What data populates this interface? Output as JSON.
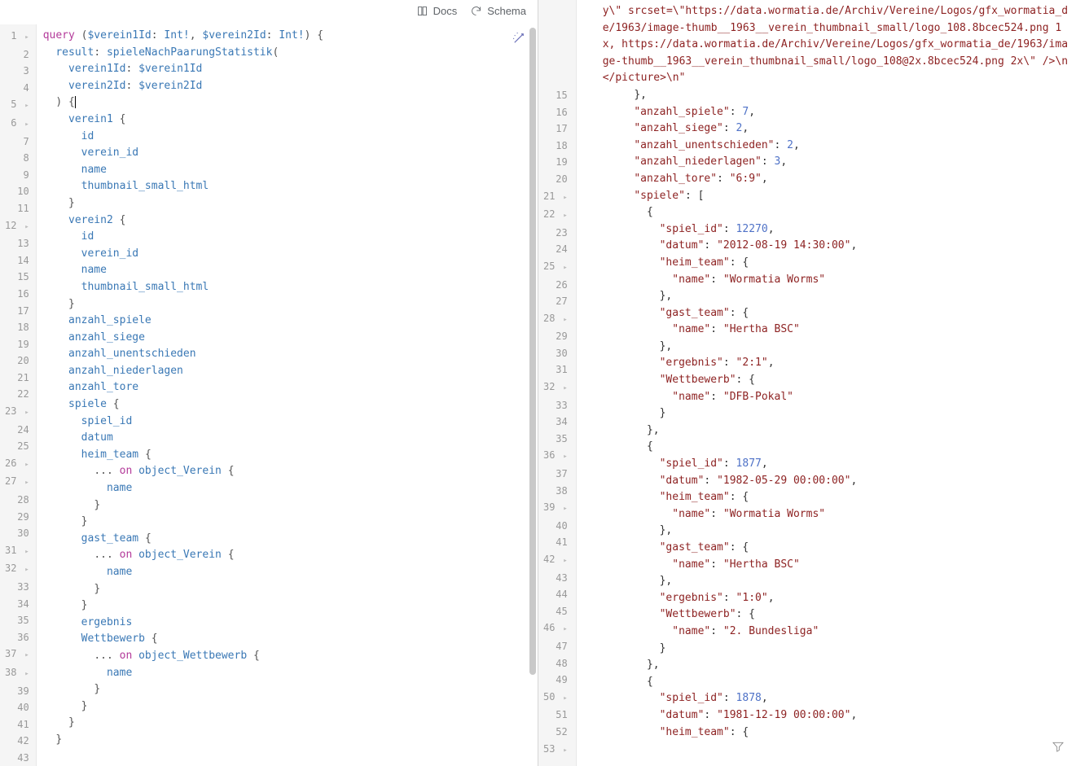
{
  "toolbar": {
    "docs_label": "Docs",
    "schema_label": "Schema"
  },
  "left_gutter_start": 1,
  "left_gutter_end": 43,
  "query_lines": [
    {
      "indent": 0,
      "fold": true,
      "html": "<span class='tok-kw'>query</span> <span class='tok-punc'>(</span><span class='tok-type'>$verein1Id</span><span class='tok-punc'>:</span> <span class='tok-type'>Int!</span><span class='tok-punc'>,</span> <span class='tok-type'>$verein2Id</span><span class='tok-punc'>:</span> <span class='tok-type'>Int!</span><span class='tok-punc'>)</span> <span class='tok-punc'>{</span>"
    },
    {
      "indent": 1,
      "html": "<span class='tok-alias'>result</span><span class='tok-punc'>:</span> <span class='tok-field'>spieleNachPaarungStatistik</span><span class='tok-punc'>(</span>"
    },
    {
      "indent": 2,
      "html": "<span class='tok-field'>verein1Id</span><span class='tok-punc'>:</span> <span class='tok-type'>$verein1Id</span>"
    },
    {
      "indent": 2,
      "html": "<span class='tok-field'>verein2Id</span><span class='tok-punc'>:</span> <span class='tok-type'>$verein2Id</span>"
    },
    {
      "indent": 1,
      "fold": true,
      "cursor": true,
      "html": "<span class='tok-punc'>)</span> <span class='tok-punc'>{</span>"
    },
    {
      "indent": 2,
      "fold": true,
      "html": "<span class='tok-field'>verein1</span> <span class='tok-punc'>{</span>"
    },
    {
      "indent": 3,
      "html": "<span class='tok-field'>id</span>"
    },
    {
      "indent": 3,
      "html": "<span class='tok-field'>verein_id</span>"
    },
    {
      "indent": 3,
      "html": "<span class='tok-field'>name</span>"
    },
    {
      "indent": 3,
      "html": "<span class='tok-field'>thumbnail_small_html</span>"
    },
    {
      "indent": 2,
      "html": "<span class='tok-punc'>}</span>"
    },
    {
      "indent": 2,
      "fold": true,
      "html": "<span class='tok-field'>verein2</span> <span class='tok-punc'>{</span>"
    },
    {
      "indent": 3,
      "html": "<span class='tok-field'>id</span>"
    },
    {
      "indent": 3,
      "html": "<span class='tok-field'>verein_id</span>"
    },
    {
      "indent": 3,
      "html": "<span class='tok-field'>name</span>"
    },
    {
      "indent": 3,
      "html": "<span class='tok-field'>thumbnail_small_html</span>"
    },
    {
      "indent": 2,
      "html": "<span class='tok-punc'>}</span>"
    },
    {
      "indent": 2,
      "html": "<span class='tok-field'>anzahl_spiele</span>"
    },
    {
      "indent": 2,
      "html": "<span class='tok-field'>anzahl_siege</span>"
    },
    {
      "indent": 2,
      "html": "<span class='tok-field'>anzahl_unentschieden</span>"
    },
    {
      "indent": 2,
      "html": "<span class='tok-field'>anzahl_niederlagen</span>"
    },
    {
      "indent": 2,
      "html": "<span class='tok-field'>anzahl_tore</span>"
    },
    {
      "indent": 2,
      "fold": true,
      "html": "<span class='tok-field'>spiele</span> <span class='tok-punc'>{</span>"
    },
    {
      "indent": 3,
      "html": "<span class='tok-field'>spiel_id</span>"
    },
    {
      "indent": 3,
      "html": "<span class='tok-field'>datum</span>"
    },
    {
      "indent": 3,
      "fold": true,
      "html": "<span class='tok-field'>heim_team</span> <span class='tok-punc'>{</span>"
    },
    {
      "indent": 4,
      "fold": true,
      "html": "<span class='tok-punc'>...</span> <span class='tok-kw'>on</span> <span class='tok-type'>object_Verein</span> <span class='tok-punc'>{</span>"
    },
    {
      "indent": 5,
      "html": "<span class='tok-field'>name</span>"
    },
    {
      "indent": 4,
      "html": "<span class='tok-punc'>}</span>"
    },
    {
      "indent": 3,
      "html": "<span class='tok-punc'>}</span>"
    },
    {
      "indent": 3,
      "fold": true,
      "html": "<span class='tok-field'>gast_team</span> <span class='tok-punc'>{</span>"
    },
    {
      "indent": 4,
      "fold": true,
      "html": "<span class='tok-punc'>...</span> <span class='tok-kw'>on</span> <span class='tok-type'>object_Verein</span> <span class='tok-punc'>{</span>"
    },
    {
      "indent": 5,
      "html": "<span class='tok-field'>name</span>"
    },
    {
      "indent": 4,
      "html": "<span class='tok-punc'>}</span>"
    },
    {
      "indent": 3,
      "html": "<span class='tok-punc'>}</span>"
    },
    {
      "indent": 3,
      "html": "<span class='tok-field'>ergebnis</span>"
    },
    {
      "indent": 3,
      "fold": true,
      "html": "<span class='tok-field'>Wettbewerb</span> <span class='tok-punc'>{</span>"
    },
    {
      "indent": 4,
      "fold": true,
      "html": "<span class='tok-punc'>...</span> <span class='tok-kw'>on</span> <span class='tok-type'>object_Wettbewerb</span> <span class='tok-punc'>{</span>"
    },
    {
      "indent": 5,
      "html": "<span class='tok-field'>name</span>"
    },
    {
      "indent": 4,
      "html": "<span class='tok-punc'>}</span>"
    },
    {
      "indent": 3,
      "html": "<span class='tok-punc'>}</span>"
    },
    {
      "indent": 2,
      "html": "<span class='tok-punc'>}</span>"
    },
    {
      "indent": 1,
      "html": "<span class='tok-punc'>}</span>"
    }
  ],
  "right_top_text": "y\\\" srcset=\\\"https://data.wormatia.de/Archiv/Vereine/Logos/gfx_wormatia_de/1963/image-thumb__1963__verein_thumbnail_small/logo_108.8bcec524.png 1x, https://data.wormatia.de/Archiv/Vereine/Logos/gfx_wormatia_de/1963/image-thumb__1963__verein_thumbnail_small/logo_108@2x.8bcec524.png 2x\\\" />\\n</picture>\\n\"",
  "right_gutter": [
    15,
    16,
    17,
    18,
    19,
    20,
    21,
    22,
    23,
    24,
    25,
    26,
    27,
    28,
    29,
    30,
    31,
    32,
    33,
    34,
    35,
    36,
    37,
    38,
    39,
    40,
    41,
    42,
    43,
    44,
    45,
    46,
    47,
    48,
    49,
    50,
    51,
    52,
    53
  ],
  "right_fold_lines": [
    21,
    22,
    25,
    28,
    32,
    36,
    39,
    42,
    46,
    50,
    53
  ],
  "result_lines": [
    {
      "n": 15,
      "indent": 4,
      "parts": [
        {
          "t": "plain",
          "v": "},"
        }
      ]
    },
    {
      "n": 16,
      "indent": 4,
      "parts": [
        {
          "t": "key",
          "v": "\"anzahl_spiele\""
        },
        {
          "t": "plain",
          "v": ": "
        },
        {
          "t": "num",
          "v": "7"
        },
        {
          "t": "plain",
          "v": ","
        }
      ]
    },
    {
      "n": 17,
      "indent": 4,
      "parts": [
        {
          "t": "key",
          "v": "\"anzahl_siege\""
        },
        {
          "t": "plain",
          "v": ": "
        },
        {
          "t": "num",
          "v": "2"
        },
        {
          "t": "plain",
          "v": ","
        }
      ]
    },
    {
      "n": 18,
      "indent": 4,
      "parts": [
        {
          "t": "key",
          "v": "\"anzahl_unentschieden\""
        },
        {
          "t": "plain",
          "v": ": "
        },
        {
          "t": "num",
          "v": "2"
        },
        {
          "t": "plain",
          "v": ","
        }
      ]
    },
    {
      "n": 19,
      "indent": 4,
      "parts": [
        {
          "t": "key",
          "v": "\"anzahl_niederlagen\""
        },
        {
          "t": "plain",
          "v": ": "
        },
        {
          "t": "num",
          "v": "3"
        },
        {
          "t": "plain",
          "v": ","
        }
      ]
    },
    {
      "n": 20,
      "indent": 4,
      "parts": [
        {
          "t": "key",
          "v": "\"anzahl_tore\""
        },
        {
          "t": "plain",
          "v": ": "
        },
        {
          "t": "str",
          "v": "\"6:9\""
        },
        {
          "t": "plain",
          "v": ","
        }
      ]
    },
    {
      "n": 21,
      "indent": 4,
      "parts": [
        {
          "t": "key",
          "v": "\"spiele\""
        },
        {
          "t": "plain",
          "v": ": ["
        }
      ]
    },
    {
      "n": 22,
      "indent": 5,
      "parts": [
        {
          "t": "plain",
          "v": "{"
        }
      ]
    },
    {
      "n": 23,
      "indent": 6,
      "parts": [
        {
          "t": "key",
          "v": "\"spiel_id\""
        },
        {
          "t": "plain",
          "v": ": "
        },
        {
          "t": "num",
          "v": "12270"
        },
        {
          "t": "plain",
          "v": ","
        }
      ]
    },
    {
      "n": 24,
      "indent": 6,
      "parts": [
        {
          "t": "key",
          "v": "\"datum\""
        },
        {
          "t": "plain",
          "v": ": "
        },
        {
          "t": "str",
          "v": "\"2012-08-19 14:30:00\""
        },
        {
          "t": "plain",
          "v": ","
        }
      ]
    },
    {
      "n": 25,
      "indent": 6,
      "parts": [
        {
          "t": "key",
          "v": "\"heim_team\""
        },
        {
          "t": "plain",
          "v": ": {"
        }
      ]
    },
    {
      "n": 26,
      "indent": 7,
      "parts": [
        {
          "t": "key",
          "v": "\"name\""
        },
        {
          "t": "plain",
          "v": ": "
        },
        {
          "t": "str",
          "v": "\"Wormatia Worms\""
        }
      ]
    },
    {
      "n": 27,
      "indent": 6,
      "parts": [
        {
          "t": "plain",
          "v": "},"
        }
      ]
    },
    {
      "n": 28,
      "indent": 6,
      "parts": [
        {
          "t": "key",
          "v": "\"gast_team\""
        },
        {
          "t": "plain",
          "v": ": {"
        }
      ]
    },
    {
      "n": 29,
      "indent": 7,
      "parts": [
        {
          "t": "key",
          "v": "\"name\""
        },
        {
          "t": "plain",
          "v": ": "
        },
        {
          "t": "str",
          "v": "\"Hertha BSC\""
        }
      ]
    },
    {
      "n": 30,
      "indent": 6,
      "parts": [
        {
          "t": "plain",
          "v": "},"
        }
      ]
    },
    {
      "n": 31,
      "indent": 6,
      "parts": [
        {
          "t": "key",
          "v": "\"ergebnis\""
        },
        {
          "t": "plain",
          "v": ": "
        },
        {
          "t": "str",
          "v": "\"2:1\""
        },
        {
          "t": "plain",
          "v": ","
        }
      ]
    },
    {
      "n": 32,
      "indent": 6,
      "parts": [
        {
          "t": "key",
          "v": "\"Wettbewerb\""
        },
        {
          "t": "plain",
          "v": ": {"
        }
      ]
    },
    {
      "n": 33,
      "indent": 7,
      "parts": [
        {
          "t": "key",
          "v": "\"name\""
        },
        {
          "t": "plain",
          "v": ": "
        },
        {
          "t": "str",
          "v": "\"DFB-Pokal\""
        }
      ]
    },
    {
      "n": 34,
      "indent": 6,
      "parts": [
        {
          "t": "plain",
          "v": "}"
        }
      ]
    },
    {
      "n": 35,
      "indent": 5,
      "parts": [
        {
          "t": "plain",
          "v": "},"
        }
      ]
    },
    {
      "n": 36,
      "indent": 5,
      "parts": [
        {
          "t": "plain",
          "v": "{"
        }
      ]
    },
    {
      "n": 37,
      "indent": 6,
      "parts": [
        {
          "t": "key",
          "v": "\"spiel_id\""
        },
        {
          "t": "plain",
          "v": ": "
        },
        {
          "t": "num",
          "v": "1877"
        },
        {
          "t": "plain",
          "v": ","
        }
      ]
    },
    {
      "n": 38,
      "indent": 6,
      "parts": [
        {
          "t": "key",
          "v": "\"datum\""
        },
        {
          "t": "plain",
          "v": ": "
        },
        {
          "t": "str",
          "v": "\"1982-05-29 00:00:00\""
        },
        {
          "t": "plain",
          "v": ","
        }
      ]
    },
    {
      "n": 39,
      "indent": 6,
      "parts": [
        {
          "t": "key",
          "v": "\"heim_team\""
        },
        {
          "t": "plain",
          "v": ": {"
        }
      ]
    },
    {
      "n": 40,
      "indent": 7,
      "parts": [
        {
          "t": "key",
          "v": "\"name\""
        },
        {
          "t": "plain",
          "v": ": "
        },
        {
          "t": "str",
          "v": "\"Wormatia Worms\""
        }
      ]
    },
    {
      "n": 41,
      "indent": 6,
      "parts": [
        {
          "t": "plain",
          "v": "},"
        }
      ]
    },
    {
      "n": 42,
      "indent": 6,
      "parts": [
        {
          "t": "key",
          "v": "\"gast_team\""
        },
        {
          "t": "plain",
          "v": ": {"
        }
      ]
    },
    {
      "n": 43,
      "indent": 7,
      "parts": [
        {
          "t": "key",
          "v": "\"name\""
        },
        {
          "t": "plain",
          "v": ": "
        },
        {
          "t": "str",
          "v": "\"Hertha BSC\""
        }
      ]
    },
    {
      "n": 44,
      "indent": 6,
      "parts": [
        {
          "t": "plain",
          "v": "},"
        }
      ]
    },
    {
      "n": 45,
      "indent": 6,
      "parts": [
        {
          "t": "key",
          "v": "\"ergebnis\""
        },
        {
          "t": "plain",
          "v": ": "
        },
        {
          "t": "str",
          "v": "\"1:0\""
        },
        {
          "t": "plain",
          "v": ","
        }
      ]
    },
    {
      "n": 46,
      "indent": 6,
      "parts": [
        {
          "t": "key",
          "v": "\"Wettbewerb\""
        },
        {
          "t": "plain",
          "v": ": {"
        }
      ]
    },
    {
      "n": 47,
      "indent": 7,
      "parts": [
        {
          "t": "key",
          "v": "\"name\""
        },
        {
          "t": "plain",
          "v": ": "
        },
        {
          "t": "str",
          "v": "\"2. Bundesliga\""
        }
      ]
    },
    {
      "n": 48,
      "indent": 6,
      "parts": [
        {
          "t": "plain",
          "v": "}"
        }
      ]
    },
    {
      "n": 49,
      "indent": 5,
      "parts": [
        {
          "t": "plain",
          "v": "},"
        }
      ]
    },
    {
      "n": 50,
      "indent": 5,
      "parts": [
        {
          "t": "plain",
          "v": "{"
        }
      ]
    },
    {
      "n": 51,
      "indent": 6,
      "parts": [
        {
          "t": "key",
          "v": "\"spiel_id\""
        },
        {
          "t": "plain",
          "v": ": "
        },
        {
          "t": "num",
          "v": "1878"
        },
        {
          "t": "plain",
          "v": ","
        }
      ]
    },
    {
      "n": 52,
      "indent": 6,
      "parts": [
        {
          "t": "key",
          "v": "\"datum\""
        },
        {
          "t": "plain",
          "v": ": "
        },
        {
          "t": "str",
          "v": "\"1981-12-19 00:00:00\""
        },
        {
          "t": "plain",
          "v": ","
        }
      ]
    },
    {
      "n": 53,
      "indent": 6,
      "parts": [
        {
          "t": "key",
          "v": "\"heim_team\""
        },
        {
          "t": "plain",
          "v": ": {"
        }
      ]
    }
  ]
}
